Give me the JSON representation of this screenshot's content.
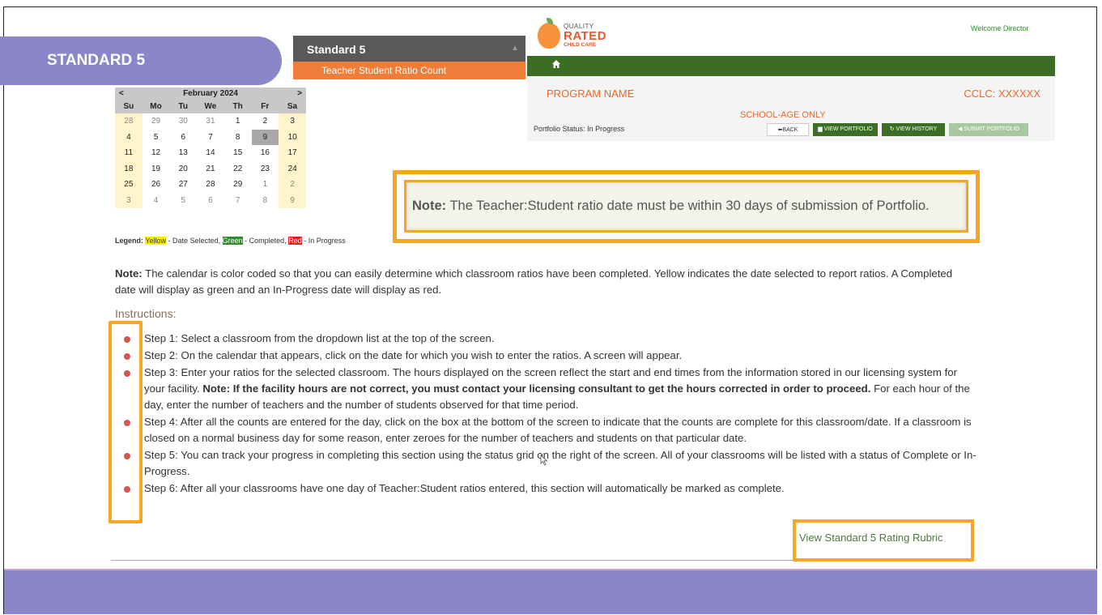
{
  "slide": {
    "title": "STANDARD 5"
  },
  "standard_menu": {
    "title": "Standard 5",
    "item": "Teacher Student Ratio Count"
  },
  "app": {
    "logo": {
      "line1": "QUALITY",
      "line2": "RATED",
      "line3": "CHILD CARE"
    },
    "welcome": "Welcome Director",
    "program_name": "PROGRAM NAME",
    "cclc": "CCLC: XXXXXX",
    "school_age": "SCHOOL-AGE ONLY",
    "portfolio_status_label": "Portfolio Status:",
    "portfolio_status_value": "In Progress",
    "buttons": {
      "back": "BACK",
      "view_portfolio": "VIEW PORTFOLIO",
      "view_history": "VIEW HISTORY",
      "submit_portfolio": "SUBMIT PORTFOLIO"
    }
  },
  "calendar": {
    "prev": "<",
    "next": ">",
    "month": "February 2024",
    "dow": [
      "Su",
      "Mo",
      "Tu",
      "We",
      "Th",
      "Fr",
      "Sa"
    ],
    "days": [
      "28",
      "29",
      "30",
      "31",
      "1",
      "2",
      "3",
      "4",
      "5",
      "6",
      "7",
      "8",
      "9",
      "10",
      "11",
      "12",
      "13",
      "14",
      "15",
      "16",
      "17",
      "18",
      "19",
      "20",
      "21",
      "22",
      "23",
      "24",
      "25",
      "26",
      "27",
      "28",
      "29",
      "1",
      "2",
      "3",
      "4",
      "5",
      "6",
      "7",
      "8",
      "9"
    ],
    "outside_indices": [
      0,
      1,
      2,
      3,
      33,
      34,
      35,
      36,
      37,
      38,
      39,
      40,
      41
    ],
    "selected_index": 12
  },
  "legend": {
    "label": "Legend:",
    "yellow": "Yellow",
    "yellow_desc": "- Date Selected,",
    "green": "Green",
    "green_desc": "- Completed,",
    "red": "Red",
    "red_desc": "- In Progress"
  },
  "note_box": {
    "label": "Note:",
    "text": "The Teacher:Student ratio date must be within 30 days of submission of Portfolio."
  },
  "calendar_note": {
    "label": "Note:",
    "text": "The calendar is color coded so that you can easily determine which classroom ratios have been completed. Yellow indicates the date selected to report ratios. A Completed date will display as green and an In-Progress date will display as red."
  },
  "instructions": {
    "heading": "Instructions:",
    "step1": "Step 1: Select a classroom from the dropdown list at the top of the screen.",
    "step2": "Step 2: On the calendar that appears, click on the date for which you wish to enter the ratios. A screen will appear.",
    "step3_a": "Step 3: Enter your ratios for the selected classroom. The hours displayed on the screen reflect the start and end times from the information stored in our licensing system for your facility.",
    "step3_b": "Note: If the facility hours are not correct, you must contact your licensing consultant to get the hours corrected in order to proceed.",
    "step3_c": "For each hour of the day, enter the number of teachers and the number of students observed for that time period.",
    "step4": "Step 4: After all the counts are entered for the day, click on the box at the bottom of the screen to indicate that the counts are complete for this classroom/date. If a classroom is closed on a normal business day for some reason, enter zeroes for the number of teachers and students on that particular date.",
    "step5": "Step 5: You can track your progress in completing this section using the status grid on the right of the screen. All of your classrooms will be listed with a status of Complete or In-Progress.",
    "step6": "Step 6: After all your classrooms have one day of Teacher:Student ratios entered, this section will automatically be marked as complete."
  },
  "rubric_link": "View Standard 5 Rating Rubric",
  "colors": {
    "accent_purple": "#8b86c8",
    "highlight_orange": "#f5a623",
    "nav_green": "#3b6d24",
    "brand_orange": "#e8682a"
  }
}
